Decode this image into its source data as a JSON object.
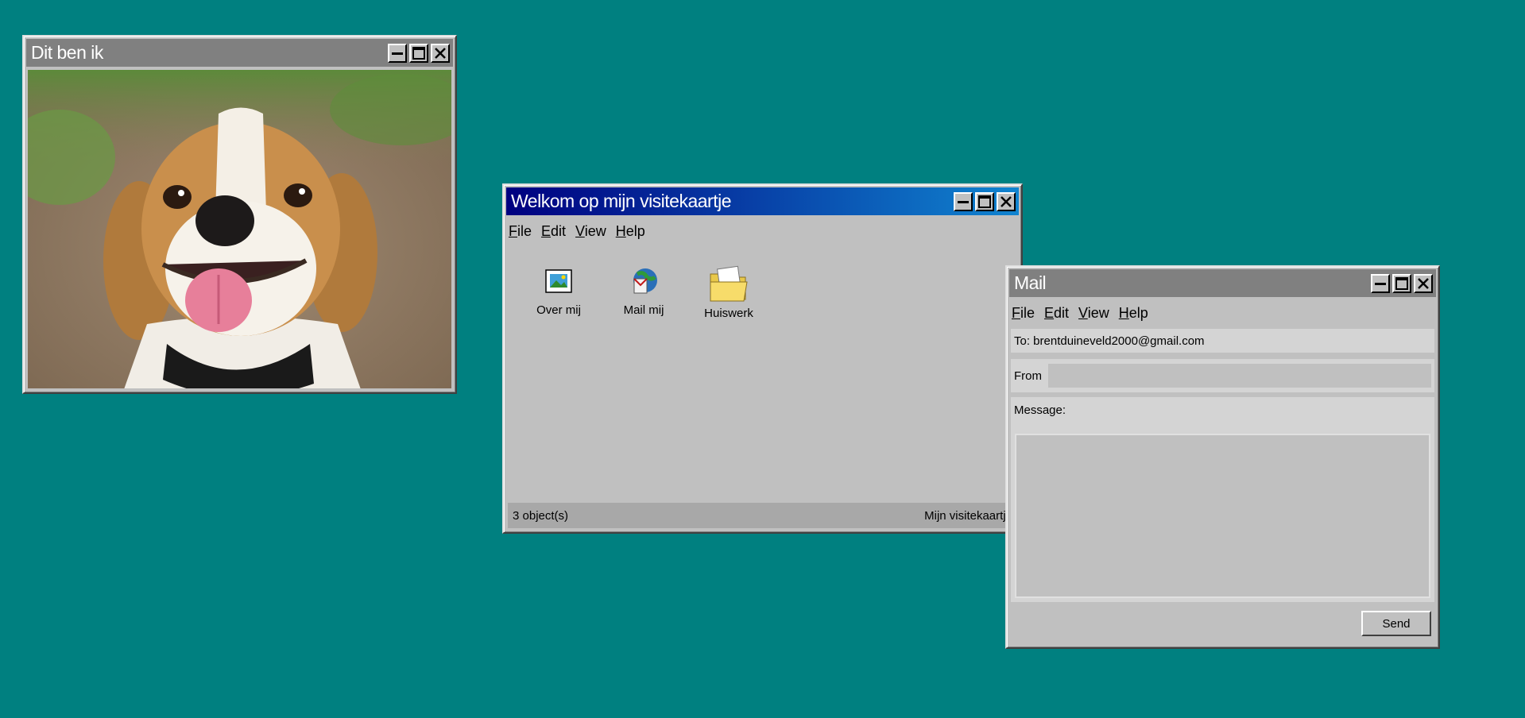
{
  "photo_window": {
    "title": "Dit ben ik",
    "image_subject": "smiling beagle dog photo"
  },
  "explorer_window": {
    "title": "Welkom op mijn visitekaartje",
    "menu": [
      "File",
      "Edit",
      "View",
      "Help"
    ],
    "icons": [
      {
        "label": "Over mij",
        "icon": "picture-icon"
      },
      {
        "label": "Mail mij",
        "icon": "mail-globe-icon"
      },
      {
        "label": "Huiswerk",
        "icon": "folder-icon"
      }
    ],
    "status_left": "3 object(s)",
    "status_right": "Mijn visitekaartje"
  },
  "mail_window": {
    "title": "Mail",
    "menu": [
      "File",
      "Edit",
      "View",
      "Help"
    ],
    "to": "To: brentduineveld2000@gmail.com",
    "from_label": "From",
    "from_value": "",
    "message_label": "Message:",
    "message_value": "",
    "send_label": "Send"
  },
  "colors": {
    "desktop": "#008080",
    "window_face": "#c0c0c0",
    "active_title_start": "#000080",
    "active_title_end": "#1084d0",
    "inactive_title": "#808080"
  }
}
